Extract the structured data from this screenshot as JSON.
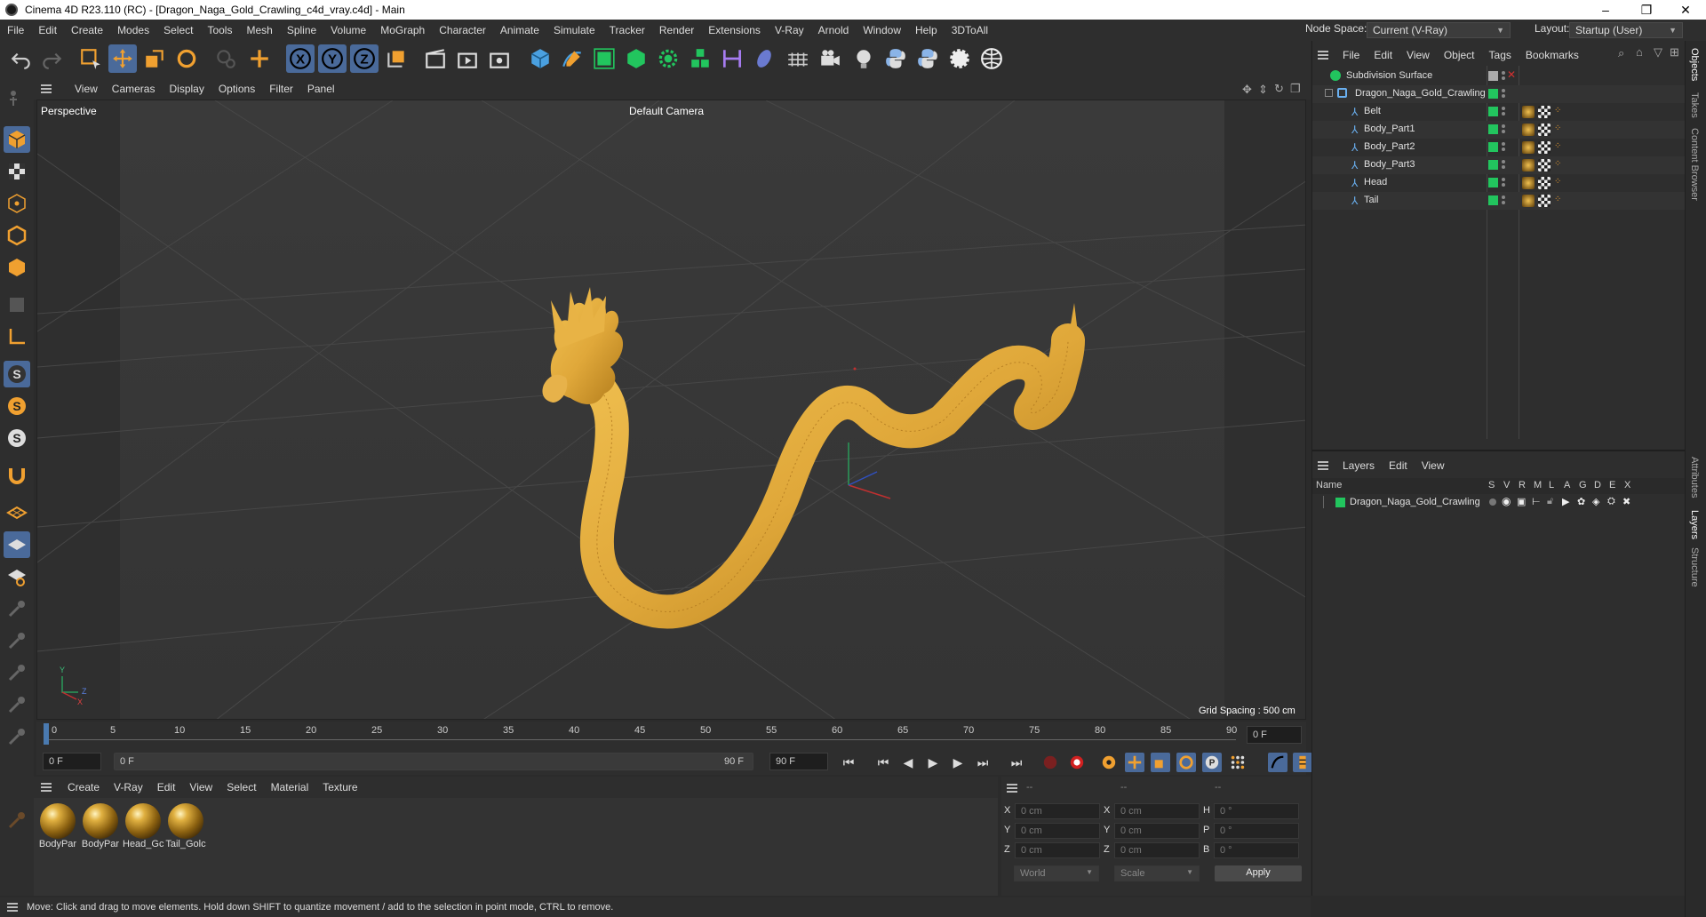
{
  "window": {
    "title": "Cinema 4D R23.110 (RC) - [Dragon_Naga_Gold_Crawling_c4d_vray.c4d] - Main",
    "controls": [
      "–",
      "❐",
      "✕"
    ]
  },
  "menubar": {
    "items": [
      "File",
      "Edit",
      "Create",
      "Modes",
      "Select",
      "Tools",
      "Mesh",
      "Spline",
      "Volume",
      "MoGraph",
      "Character",
      "Animate",
      "Simulate",
      "Tracker",
      "Render",
      "Extensions",
      "V-Ray",
      "Arnold",
      "Window",
      "Help",
      "3DToAll"
    ],
    "node_space_label": "Node Space:",
    "node_space_value": "Current (V-Ray)",
    "layout_label": "Layout:",
    "layout_value": "Startup (User)"
  },
  "viewport": {
    "menu": [
      "View",
      "Cameras",
      "Display",
      "Options",
      "Filter",
      "Panel"
    ],
    "projection": "Perspective",
    "camera": "Default Camera",
    "grid_spacing": "Grid Spacing : 500 cm",
    "axis_labels": {
      "y": "Y",
      "z": "Z",
      "x": "X"
    },
    "model_color": "#e0a83a"
  },
  "timeline": {
    "ticks": [
      "0",
      "5",
      "10",
      "15",
      "20",
      "25",
      "30",
      "35",
      "40",
      "45",
      "50",
      "55",
      "60",
      "65",
      "70",
      "75",
      "80",
      "85",
      "90"
    ],
    "current_frame_right": "0 F",
    "start_field": "0 F",
    "range_start": "0 F",
    "range_end": "90 F",
    "end_field": "90 F"
  },
  "materials": {
    "menu": [
      "Create",
      "V-Ray",
      "Edit",
      "View",
      "Select",
      "Material",
      "Texture"
    ],
    "items": [
      "BodyPar",
      "BodyPar",
      "Head_Gc",
      "Tail_Golc"
    ]
  },
  "coordinates": {
    "header": [
      "--",
      "--",
      "--"
    ],
    "rows": [
      {
        "a": "X",
        "av": "0 cm",
        "b": "X",
        "bv": "0 cm",
        "c": "H",
        "cv": "0 °"
      },
      {
        "a": "Y",
        "av": "0 cm",
        "b": "Y",
        "bv": "0 cm",
        "c": "P",
        "cv": "0 °"
      },
      {
        "a": "Z",
        "av": "0 cm",
        "b": "Z",
        "bv": "0 cm",
        "c": "B",
        "cv": "0 °"
      }
    ],
    "world": "World",
    "scale": "Scale",
    "apply": "Apply"
  },
  "status": "Move: Click and drag to move elements. Hold down SHIFT to quantize movement / add to the selection in point mode, CTRL to remove.",
  "objects": {
    "menu": [
      "File",
      "Edit",
      "View",
      "Object",
      "Tags",
      "Bookmarks"
    ],
    "tree": [
      {
        "name": "Subdivision Surface",
        "indent": 0
      },
      {
        "name": "Dragon_Naga_Gold_Crawling",
        "indent": 1
      },
      {
        "name": "Belt",
        "indent": 2
      },
      {
        "name": "Body_Part1",
        "indent": 2
      },
      {
        "name": "Body_Part2",
        "indent": 2
      },
      {
        "name": "Body_Part3",
        "indent": 2
      },
      {
        "name": "Head",
        "indent": 2
      },
      {
        "name": "Tail",
        "indent": 2
      }
    ]
  },
  "layers": {
    "menu": [
      "Layers",
      "Edit",
      "View"
    ],
    "header_name": "Name",
    "columns": [
      "S",
      "V",
      "R",
      "M",
      "L",
      "A",
      "G",
      "D",
      "E",
      "X"
    ],
    "rows": [
      {
        "name": "Dragon_Naga_Gold_Crawling",
        "color": "#22c55e"
      }
    ]
  },
  "side_tabs": [
    "Objects",
    "Takes",
    "Content Browser",
    "Attributes",
    "Layers",
    "Structure"
  ]
}
